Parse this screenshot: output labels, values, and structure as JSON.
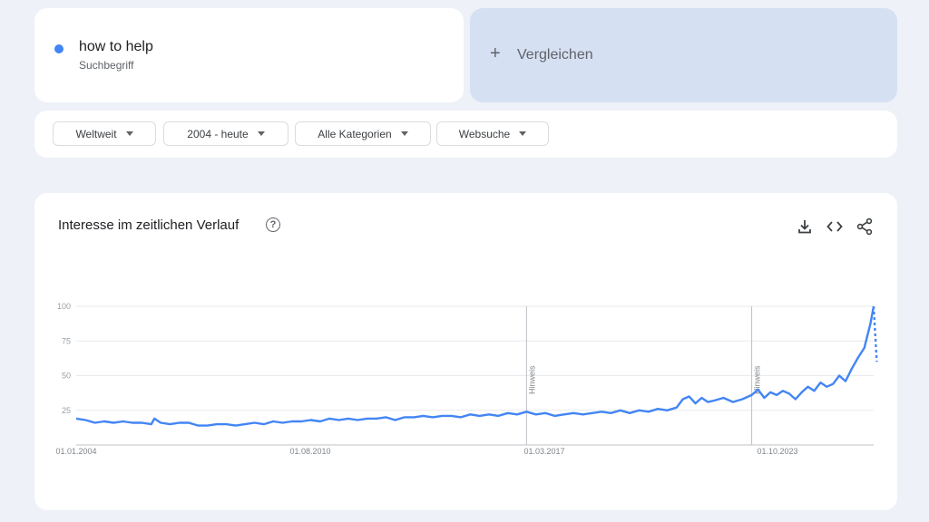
{
  "term": {
    "name": "how to help",
    "type": "Suchbegriff",
    "color": "#4285f4"
  },
  "compare": {
    "icon": "+",
    "label": "Vergleichen"
  },
  "filters": [
    {
      "label": "Weltweit"
    },
    {
      "label": "2004 - heute"
    },
    {
      "label": "Alle Kategorien"
    },
    {
      "label": "Websuche"
    }
  ],
  "chart_panel": {
    "title": "Interesse im zeitlichen Verlauf",
    "help_icon": "?",
    "icons": [
      "download-icon",
      "embed-icon",
      "share-icon"
    ]
  },
  "chart_data": {
    "type": "line",
    "title": "",
    "xlabel": "",
    "ylabel": "",
    "ylim": [
      0,
      100
    ],
    "y_ticks": [
      "100",
      "75",
      "50",
      "25"
    ],
    "x_ticks": [
      "01.01.2004",
      "01.08.2010",
      "01.03.2017",
      "01.10.2023"
    ],
    "x_range": [
      "2004-01",
      "2025-04"
    ],
    "annotations": [
      {
        "label": "Hinweis",
        "x": "2016-01"
      },
      {
        "label": "Hinweis",
        "x": "2022-01"
      }
    ],
    "series": [
      {
        "color": "#4285f4",
        "points": [
          [
            "2004-01",
            19
          ],
          [
            "2004-04",
            18
          ],
          [
            "2004-07",
            16
          ],
          [
            "2004-10",
            17
          ],
          [
            "2005-01",
            16
          ],
          [
            "2005-04",
            17
          ],
          [
            "2005-07",
            16
          ],
          [
            "2005-10",
            16
          ],
          [
            "2006-01",
            15
          ],
          [
            "2006-02",
            19
          ],
          [
            "2006-04",
            16
          ],
          [
            "2006-07",
            15
          ],
          [
            "2006-10",
            16
          ],
          [
            "2007-01",
            16
          ],
          [
            "2007-04",
            14
          ],
          [
            "2007-07",
            14
          ],
          [
            "2007-10",
            15
          ],
          [
            "2008-01",
            15
          ],
          [
            "2008-04",
            14
          ],
          [
            "2008-07",
            15
          ],
          [
            "2008-10",
            16
          ],
          [
            "2009-01",
            15
          ],
          [
            "2009-04",
            17
          ],
          [
            "2009-07",
            16
          ],
          [
            "2009-10",
            17
          ],
          [
            "2010-01",
            17
          ],
          [
            "2010-04",
            18
          ],
          [
            "2010-07",
            17
          ],
          [
            "2010-10",
            19
          ],
          [
            "2011-01",
            18
          ],
          [
            "2011-04",
            19
          ],
          [
            "2011-07",
            18
          ],
          [
            "2011-10",
            19
          ],
          [
            "2012-01",
            19
          ],
          [
            "2012-04",
            20
          ],
          [
            "2012-07",
            18
          ],
          [
            "2012-10",
            20
          ],
          [
            "2013-01",
            20
          ],
          [
            "2013-04",
            21
          ],
          [
            "2013-07",
            20
          ],
          [
            "2013-10",
            21
          ],
          [
            "2014-01",
            21
          ],
          [
            "2014-04",
            20
          ],
          [
            "2014-07",
            22
          ],
          [
            "2014-10",
            21
          ],
          [
            "2015-01",
            22
          ],
          [
            "2015-04",
            21
          ],
          [
            "2015-07",
            23
          ],
          [
            "2015-10",
            22
          ],
          [
            "2016-01",
            24
          ],
          [
            "2016-04",
            22
          ],
          [
            "2016-07",
            23
          ],
          [
            "2016-10",
            21
          ],
          [
            "2017-01",
            22
          ],
          [
            "2017-04",
            23
          ],
          [
            "2017-07",
            22
          ],
          [
            "2017-10",
            23
          ],
          [
            "2018-01",
            24
          ],
          [
            "2018-04",
            23
          ],
          [
            "2018-07",
            25
          ],
          [
            "2018-10",
            23
          ],
          [
            "2019-01",
            25
          ],
          [
            "2019-04",
            24
          ],
          [
            "2019-07",
            26
          ],
          [
            "2019-10",
            25
          ],
          [
            "2020-01",
            27
          ],
          [
            "2020-03",
            33
          ],
          [
            "2020-05",
            35
          ],
          [
            "2020-07",
            30
          ],
          [
            "2020-09",
            34
          ],
          [
            "2020-11",
            31
          ],
          [
            "2021-01",
            32
          ],
          [
            "2021-04",
            34
          ],
          [
            "2021-07",
            31
          ],
          [
            "2021-10",
            33
          ],
          [
            "2022-01",
            36
          ],
          [
            "2022-03",
            40
          ],
          [
            "2022-05",
            34
          ],
          [
            "2022-07",
            38
          ],
          [
            "2022-09",
            36
          ],
          [
            "2022-11",
            39
          ],
          [
            "2023-01",
            37
          ],
          [
            "2023-03",
            33
          ],
          [
            "2023-05",
            38
          ],
          [
            "2023-07",
            42
          ],
          [
            "2023-09",
            39
          ],
          [
            "2023-11",
            45
          ],
          [
            "2024-01",
            42
          ],
          [
            "2024-03",
            44
          ],
          [
            "2024-05",
            50
          ],
          [
            "2024-07",
            46
          ],
          [
            "2024-09",
            55
          ],
          [
            "2024-11",
            63
          ],
          [
            "2025-01",
            70
          ],
          [
            "2025-03",
            88
          ],
          [
            "2025-04",
            100
          ]
        ],
        "partial_points": [
          [
            "2025-04",
            100
          ],
          [
            "2025-05",
            60
          ]
        ]
      }
    ]
  }
}
